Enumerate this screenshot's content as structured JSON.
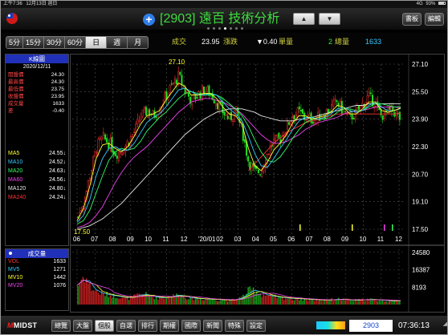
{
  "status_bar": {
    "time": "上午7:36",
    "date": "12月13日 週日",
    "network": "4G",
    "battery": "93%"
  },
  "title_bar": {
    "title": "[2903] 遠百 技術分析",
    "up_icon": "▲",
    "down_icon": "▼",
    "book_label": "書板",
    "edit_label": "編輯",
    "active_dot_index": 3
  },
  "toolbar": {
    "periods": [
      "5分",
      "15分",
      "30分",
      "60分",
      "日",
      "週",
      "月"
    ],
    "active_period": "日",
    "quote": {
      "deal_label": "成交",
      "deal_value": "23.95",
      "change_label": "漲跌",
      "change_value": "▼0.40",
      "unit_label": "單量",
      "unit_value": "2",
      "total_label": "總量",
      "total_value": "1633"
    }
  },
  "k_panel": {
    "header": "K線圖",
    "date": "2020/12/11",
    "fields": [
      {
        "k": "開盤價",
        "v": "24.30"
      },
      {
        "k": "最高價",
        "v": "24.30"
      },
      {
        "k": "最低價",
        "v": "23.75"
      },
      {
        "k": "收盤價",
        "v": "23.95"
      },
      {
        "k": "成交量",
        "v": "1633"
      },
      {
        "k": "差",
        "v": "-0.40"
      }
    ],
    "ma": [
      {
        "k": "MA5",
        "v": "24.55↓",
        "color": "#ffff33"
      },
      {
        "k": "MA10",
        "v": "24.52↓",
        "color": "#33ccff"
      },
      {
        "k": "MA20",
        "v": "24.63↓",
        "color": "#33ff66"
      },
      {
        "k": "MA60",
        "v": "24.56↓",
        "color": "#ee44ee"
      },
      {
        "k": "MA120",
        "v": "24.80↓",
        "color": "#e8e8e8"
      },
      {
        "k": "MA240",
        "v": "24.24↓",
        "color": "#ff3333"
      }
    ]
  },
  "vol_panel": {
    "header": "成交量",
    "rows": [
      {
        "k": "VOL",
        "v": "1633",
        "color": "#ff3333"
      },
      {
        "k": "MV5",
        "v": "1271",
        "color": "#33ccff"
      },
      {
        "k": "MV10",
        "v": "1442",
        "color": "#ffff33"
      },
      {
        "k": "MV20",
        "v": "1076",
        "color": "#ee44ee"
      }
    ]
  },
  "chart_data": {
    "type": "candlestick",
    "price_axis": {
      "ticks": [
        "27.10",
        "25.50",
        "23.90",
        "22.30",
        "20.70",
        "19.10",
        "17.50"
      ],
      "ylim": [
        17.5,
        27.1
      ]
    },
    "volume_axis": {
      "ticks": [
        "24580",
        "16387",
        "8193"
      ]
    },
    "x_ticks": [
      "06",
      "07",
      "08",
      "09",
      "10",
      "11",
      "12",
      "'20/01",
      "02",
      "03",
      "04",
      "05",
      "06",
      "07",
      "08",
      "09",
      "10",
      "11",
      "12"
    ],
    "annotations": {
      "high_label": "27.10",
      "low_label": "17.50"
    },
    "close_path": [
      18.2,
      19.2,
      20.8,
      22.3,
      22.8,
      22.5,
      21.9,
      22.1,
      22.6,
      23.2,
      24.1,
      24.4,
      24.1,
      24.6,
      25.3,
      25.9,
      26.4,
      25.5,
      25.0,
      25.3,
      25.6,
      25.4,
      24.9,
      24.3,
      23.9,
      24.4,
      23.3,
      21.5,
      20.8,
      20.9,
      21.9,
      22.6,
      22.7,
      23.4,
      24.1,
      24.3,
      24.0,
      23.9,
      24.0,
      24.2,
      24.5,
      24.9,
      24.4,
      24.0,
      24.2,
      24.7,
      25.2,
      24.9,
      24.1,
      24.3,
      24.4,
      23.95
    ],
    "ma5": [
      18.0,
      18.7,
      20.0,
      21.6,
      22.4,
      22.5,
      22.2,
      22.0,
      22.3,
      22.9,
      23.6,
      24.1,
      24.2,
      24.4,
      25.0,
      25.5,
      26.0,
      25.8,
      25.3,
      25.3,
      25.4,
      25.4,
      25.1,
      24.6,
      24.2,
      24.1,
      23.6,
      22.2,
      21.2,
      20.9,
      21.4,
      22.1,
      22.5,
      23.0,
      23.7,
      24.1,
      24.1,
      23.9,
      24.0,
      24.1,
      24.3,
      24.7,
      24.6,
      24.2,
      24.2,
      24.5,
      24.9,
      24.9,
      24.4,
      24.3,
      24.4,
      24.55
    ],
    "ma10": [
      17.9,
      18.3,
      19.2,
      20.6,
      21.6,
      22.2,
      22.3,
      22.1,
      22.1,
      22.5,
      23.1,
      23.7,
      24.0,
      24.2,
      24.6,
      25.1,
      25.6,
      25.7,
      25.5,
      25.3,
      25.3,
      25.4,
      25.3,
      24.9,
      24.5,
      24.2,
      23.8,
      22.9,
      21.9,
      21.2,
      21.1,
      21.6,
      22.2,
      22.7,
      23.3,
      23.8,
      24.0,
      24.0,
      23.9,
      24.0,
      24.2,
      24.5,
      24.6,
      24.4,
      24.3,
      24.4,
      24.7,
      24.9,
      24.6,
      24.4,
      24.4,
      24.52
    ],
    "ma20": [
      17.8,
      18.0,
      18.6,
      19.6,
      20.6,
      21.5,
      22.0,
      22.2,
      22.1,
      22.2,
      22.6,
      23.2,
      23.6,
      24.0,
      24.3,
      24.7,
      25.1,
      25.4,
      25.5,
      25.4,
      25.3,
      25.3,
      25.3,
      25.1,
      24.8,
      24.5,
      24.1,
      23.5,
      22.7,
      22.0,
      21.5,
      21.4,
      21.7,
      22.2,
      22.8,
      23.3,
      23.7,
      23.9,
      23.9,
      23.9,
      24.0,
      24.3,
      24.5,
      24.5,
      24.4,
      24.4,
      24.6,
      24.8,
      24.8,
      24.7,
      24.6,
      24.63
    ],
    "ma60": [
      17.6,
      17.7,
      17.9,
      18.3,
      18.8,
      19.5,
      20.2,
      20.8,
      21.3,
      21.7,
      22.0,
      22.3,
      22.7,
      23.1,
      23.5,
      23.9,
      24.3,
      24.6,
      24.9,
      25.0,
      25.1,
      25.1,
      25.0,
      24.9,
      24.7,
      24.5,
      24.2,
      23.8,
      23.4,
      23.0,
      22.7,
      22.5,
      22.5,
      22.6,
      22.8,
      23.0,
      23.3,
      23.5,
      23.7,
      23.8,
      23.9,
      24.0,
      24.2,
      24.3,
      24.4,
      24.4,
      24.5,
      24.6,
      24.6,
      24.6,
      24.6,
      24.56
    ],
    "ma120": [
      17.5,
      17.6,
      17.7,
      17.9,
      18.1,
      18.4,
      18.7,
      19.0,
      19.4,
      19.8,
      20.2,
      20.6,
      21.0,
      21.4,
      21.8,
      22.2,
      22.6,
      23.0,
      23.3,
      23.6,
      23.9,
      24.1,
      24.3,
      24.4,
      24.5,
      24.5,
      24.5,
      24.4,
      24.3,
      24.1,
      24.0,
      23.9,
      23.8,
      23.8,
      23.8,
      23.9,
      23.9,
      24.0,
      24.1,
      24.2,
      24.3,
      24.4,
      24.5,
      24.6,
      24.7,
      24.7,
      24.8,
      24.8,
      24.8,
      24.8,
      24.8,
      24.8
    ],
    "ma240": [
      null,
      null,
      null,
      null,
      null,
      null,
      null,
      null,
      null,
      null,
      null,
      null,
      null,
      null,
      null,
      null,
      null,
      null,
      null,
      null,
      null,
      null,
      null,
      null,
      null,
      null,
      null,
      20.9,
      21.3,
      21.7,
      22.1,
      22.5,
      22.8,
      23.1,
      23.3,
      23.5,
      23.7,
      23.8,
      23.9,
      24.0,
      24.1,
      24.2,
      24.2,
      24.2,
      24.2,
      24.2,
      24.2,
      24.2,
      24.2,
      24.2,
      24.2,
      24.24
    ],
    "volume": [
      9000,
      14000,
      8000,
      6000,
      5000,
      4500,
      4000,
      3500,
      3000,
      3800,
      5000,
      4500,
      3600,
      3000,
      3300,
      4000,
      4800,
      3500,
      3000,
      2800,
      2600,
      2500,
      2300,
      2200,
      2000,
      2400,
      3500,
      6500,
      7000,
      5000,
      4200,
      3800,
      3300,
      3000,
      2800,
      2700,
      2500,
      2300,
      2200,
      2000,
      2300,
      2600,
      2400,
      2100,
      2000,
      2200,
      2500,
      2300,
      2000,
      1800,
      1700,
      1633
    ]
  },
  "bottom_nav": {
    "logo_m": "M",
    "logo_text": "MIDST",
    "buttons": [
      "總覽",
      "大盤",
      "個股",
      "自選",
      "排行",
      "期權",
      "國際",
      "新聞",
      "特殊",
      "設定"
    ],
    "active": "個股",
    "code": "2903",
    "clock": "07:36:13"
  }
}
